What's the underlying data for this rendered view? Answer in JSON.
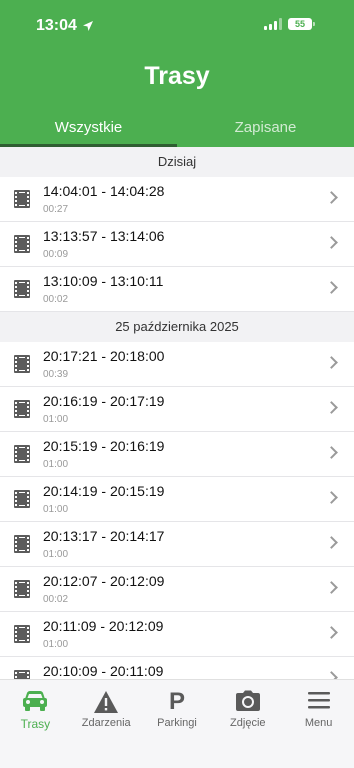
{
  "status": {
    "time": "13:04",
    "battery": "55"
  },
  "header": {
    "title": "Trasy"
  },
  "tabs": [
    {
      "label": "Wszystkie"
    },
    {
      "label": "Zapisane"
    }
  ],
  "sections": [
    {
      "title": "Dzisiaj",
      "trips": [
        {
          "range": "14:04:01 - 14:04:28",
          "duration": "00:27"
        },
        {
          "range": "13:13:57 - 13:14:06",
          "duration": "00:09"
        },
        {
          "range": "13:10:09 - 13:10:11",
          "duration": "00:02"
        }
      ]
    },
    {
      "title": "25 października 2025",
      "trips": [
        {
          "range": "20:17:21 - 20:18:00",
          "duration": "00:39"
        },
        {
          "range": "20:16:19 - 20:17:19",
          "duration": "01:00"
        },
        {
          "range": "20:15:19 - 20:16:19",
          "duration": "01:00"
        },
        {
          "range": "20:14:19 - 20:15:19",
          "duration": "01:00"
        },
        {
          "range": "20:13:17 - 20:14:17",
          "duration": "01:00"
        },
        {
          "range": "20:12:07 - 20:12:09",
          "duration": "00:02"
        },
        {
          "range": "20:11:09 - 20:12:09",
          "duration": "01:00"
        },
        {
          "range": "20:10:09 - 20:11:09",
          "duration": ""
        }
      ]
    }
  ],
  "tabbar": [
    {
      "label": "Trasy",
      "icon": "car-icon"
    },
    {
      "label": "Zdarzenia",
      "icon": "warning-icon"
    },
    {
      "label": "Parkingi",
      "icon": "parking-icon"
    },
    {
      "label": "Zdjęcie",
      "icon": "camera-icon"
    },
    {
      "label": "Menu",
      "icon": "menu-icon"
    }
  ],
  "colors": {
    "accent": "#4caf50",
    "tab_indicator": "#2f5e32"
  }
}
